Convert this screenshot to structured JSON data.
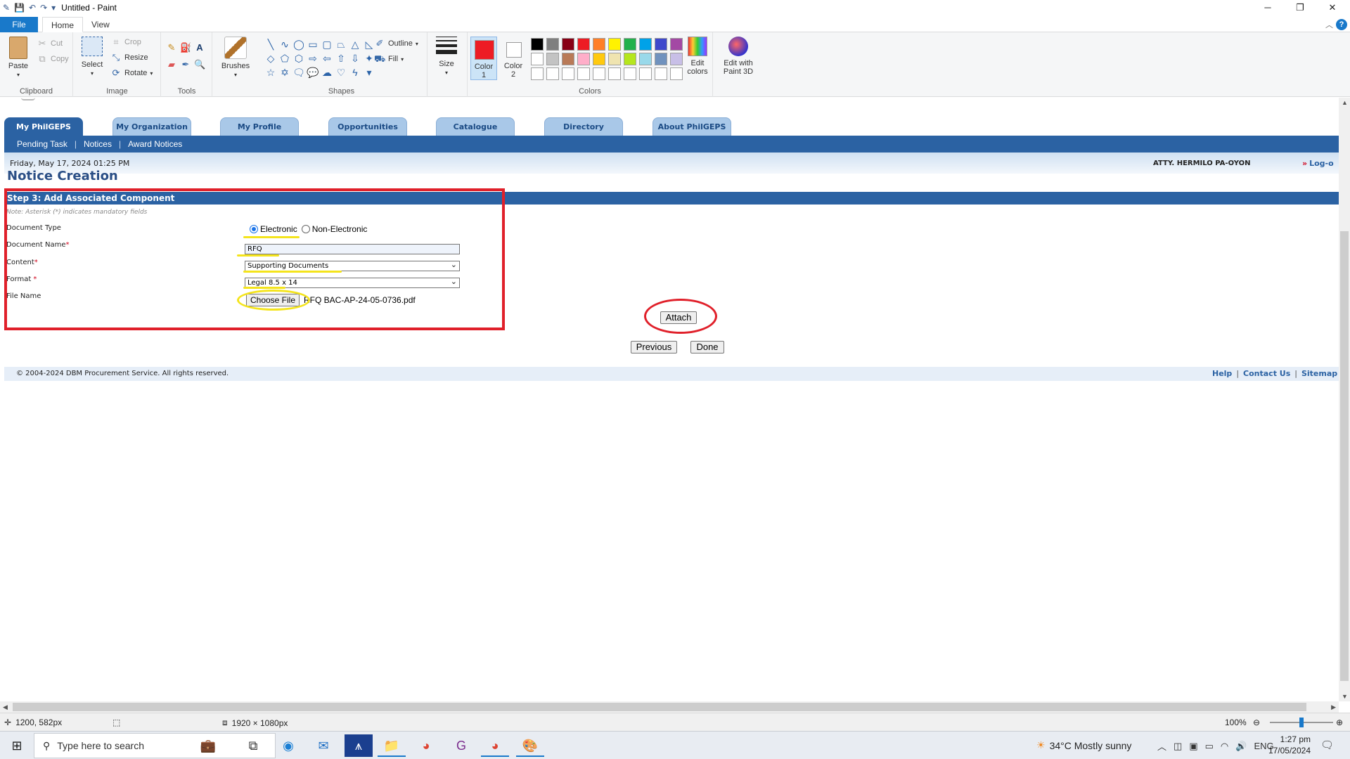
{
  "paint": {
    "title": "Untitled - Paint",
    "tabs": {
      "file": "File",
      "home": "Home",
      "view": "View"
    },
    "clipboard": {
      "paste": "Paste",
      "cut": "Cut",
      "copy": "Copy",
      "label": "Clipboard"
    },
    "image": {
      "select": "Select",
      "crop": "Crop",
      "resize": "Resize",
      "rotate": "Rotate",
      "label": "Image"
    },
    "tools": {
      "label": "Tools"
    },
    "brushes": "Brushes",
    "shapes": {
      "outline": "Outline",
      "fill": "Fill",
      "label": "Shapes"
    },
    "size": "Size",
    "color1": {
      "line1": "Color",
      "line2": "1"
    },
    "color2": {
      "line1": "Color",
      "line2": "2"
    },
    "colors_label": "Colors",
    "edit_colors": {
      "line1": "Edit",
      "line2": "colors"
    },
    "edit_paint3d": {
      "line1": "Edit with",
      "line2": "Paint 3D"
    },
    "palette_row1": [
      "#000000",
      "#7f7f7f",
      "#880015",
      "#ed1c24",
      "#ff7f27",
      "#fff200",
      "#22b14c",
      "#00a2e8",
      "#3f48cc",
      "#a349a4"
    ],
    "palette_row2": [
      "#ffffff",
      "#c3c3c3",
      "#b97a57",
      "#ffaec9",
      "#ffc90e",
      "#efe4b0",
      "#b5e61d",
      "#99d9ea",
      "#7092be",
      "#c8bfe7"
    ],
    "color1_value": "#ed1c24",
    "status": {
      "cursor": "1200, 582px",
      "dimensions": "1920 × 1080px",
      "zoom": "100%"
    }
  },
  "web": {
    "nav_tabs": [
      "My PhilGEPS",
      "My Organization",
      "My Profile",
      "Opportunities",
      "Catalogue",
      "Directory",
      "About PhilGEPS"
    ],
    "subnav": [
      "Pending Task",
      "Notices",
      "Award Notices"
    ],
    "date": "Friday, May 17, 2024 01:25 PM",
    "user": "ATTY. HERMILO PA-OYON",
    "logout": "Log-o",
    "page_title": "Notice Creation",
    "step_title": "Step 3: Add Associated Component",
    "note": "Note: Asterisk (*) indicates mandatory fields",
    "form": {
      "doc_type_label": "Document Type",
      "doc_type_opt1": "Electronic",
      "doc_type_opt2": "Non-Electronic",
      "doc_name_label": "Document Name",
      "doc_name_value": "RFQ",
      "content_label": "Content",
      "content_value": "Supporting Documents",
      "format_label": "Format ",
      "format_value": "Legal 8.5 x 14",
      "file_label": "File Name",
      "choose_file": "Choose File",
      "file_value": "RFQ BAC-AP-24-05-0736.pdf",
      "required_mark": "*"
    },
    "buttons": {
      "attach": "Attach",
      "previous": "Previous",
      "done": "Done"
    },
    "footer": {
      "copyright": "© 2004-2024  DBM Procurement Service. All rights reserved.",
      "links": [
        "Help",
        "Contact Us",
        "Sitemap"
      ]
    }
  },
  "taskbar": {
    "search_placeholder": "Type here to search",
    "weather": "34°C  Mostly sunny",
    "lang": "ENG",
    "time": "1:27 pm",
    "date": "17/05/2024"
  }
}
